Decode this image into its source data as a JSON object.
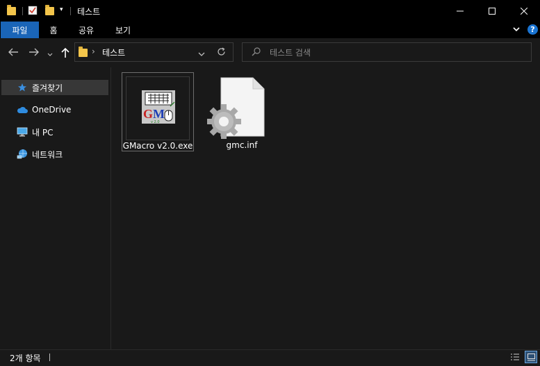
{
  "window": {
    "title": "테스트",
    "minimize_icon": "minimize-icon",
    "maximize_icon": "maximize-icon",
    "close_icon": "close-icon"
  },
  "ribbon": {
    "tabs": [
      {
        "label": "파일",
        "active": true
      },
      {
        "label": "홈"
      },
      {
        "label": "공유"
      },
      {
        "label": "보기"
      }
    ]
  },
  "address": {
    "path_segment": "테스트",
    "separator": "›"
  },
  "search": {
    "placeholder": "테스트 검색"
  },
  "sidebar": {
    "items": [
      {
        "label": "즐겨찾기",
        "icon": "star-icon",
        "selected": true
      },
      {
        "label": "OneDrive",
        "icon": "cloud-icon"
      },
      {
        "label": "내 PC",
        "icon": "computer-icon"
      },
      {
        "label": "네트워크",
        "icon": "network-icon"
      }
    ]
  },
  "files": [
    {
      "name": "GMacro v2.0.exe",
      "icon": "gmacro-app-icon",
      "selected": true
    },
    {
      "name": "gmc.inf",
      "icon": "settings-file-icon"
    }
  ],
  "status": {
    "item_count": "2개 항목"
  },
  "colors": {
    "accent": "#1a65b8",
    "background": "#191919",
    "titlebar": "#000000",
    "folder": "#f3c54b"
  }
}
